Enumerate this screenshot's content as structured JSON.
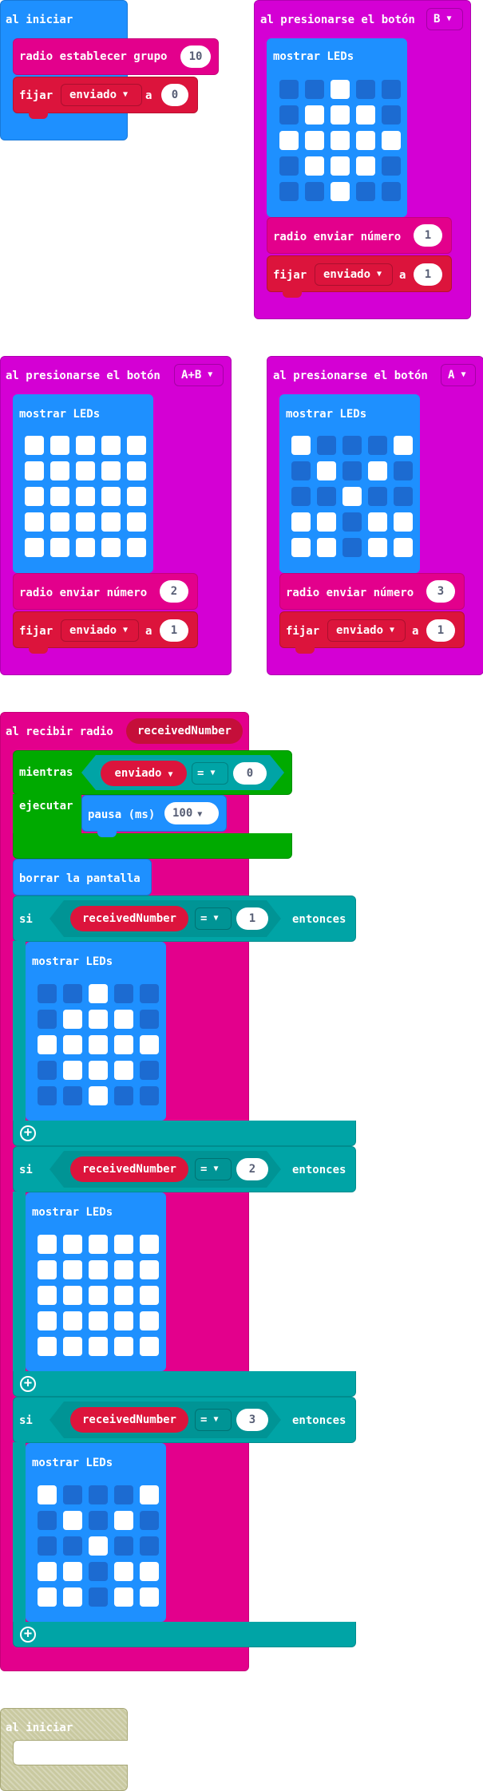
{
  "colors": {
    "basic": "#1e90ff",
    "radio": "#e3008c",
    "input": "#d400d4",
    "variables": "#dc143c",
    "loops": "#00aa00",
    "logic": "#00a4a6",
    "disabled": "#c9c9a0"
  },
  "on_start": {
    "hat_label": "al iniciar",
    "radio_group_label": "radio establecer grupo",
    "radio_group_value": "10",
    "set_label": "fijar",
    "set_variable": "enviado",
    "to_label": "a",
    "set_value": "0"
  },
  "button_b": {
    "hat_label": "al presionarse el botón",
    "button": "B",
    "show_leds_label": "mostrar LEDs",
    "leds": [
      0,
      0,
      1,
      0,
      0,
      0,
      1,
      1,
      1,
      0,
      1,
      1,
      1,
      1,
      1,
      0,
      1,
      1,
      1,
      0,
      0,
      0,
      1,
      0,
      0
    ],
    "send_label": "radio enviar número",
    "send_value": "1",
    "set_label": "fijar",
    "set_variable": "enviado",
    "to_label": "a",
    "set_value": "1"
  },
  "button_ab": {
    "hat_label": "al presionarse el botón",
    "button": "A+B",
    "show_leds_label": "mostrar LEDs",
    "leds": [
      1,
      1,
      1,
      1,
      1,
      1,
      1,
      1,
      1,
      1,
      1,
      1,
      1,
      1,
      1,
      1,
      1,
      1,
      1,
      1,
      1,
      1,
      1,
      1,
      1
    ],
    "send_label": "radio enviar número",
    "send_value": "2",
    "set_label": "fijar",
    "set_variable": "enviado",
    "to_label": "a",
    "set_value": "1"
  },
  "button_a": {
    "hat_label": "al presionarse el botón",
    "button": "A",
    "show_leds_label": "mostrar LEDs",
    "leds": [
      1,
      0,
      0,
      0,
      1,
      0,
      1,
      0,
      1,
      0,
      0,
      0,
      1,
      0,
      0,
      1,
      1,
      0,
      1,
      1,
      1,
      1,
      0,
      1,
      1
    ],
    "send_label": "radio enviar número",
    "send_value": "3",
    "set_label": "fijar",
    "set_variable": "enviado",
    "to_label": "a",
    "set_value": "1"
  },
  "on_received": {
    "hat_label": "al recibir radio",
    "param": "receivedNumber",
    "while_label": "mientras",
    "while_variable": "enviado",
    "while_op": "=",
    "while_value": "0",
    "do_label": "ejecutar",
    "pause_label": "pausa (ms)",
    "pause_value": "100",
    "clear_label": "borrar la pantalla",
    "if_blocks": [
      {
        "if_label": "si",
        "variable": "receivedNumber",
        "op": "=",
        "value": "1",
        "then_label": "entonces",
        "show_leds_label": "mostrar LEDs",
        "leds": [
          0,
          0,
          1,
          0,
          0,
          0,
          1,
          1,
          1,
          0,
          1,
          1,
          1,
          1,
          1,
          0,
          1,
          1,
          1,
          0,
          0,
          0,
          1,
          0,
          0
        ]
      },
      {
        "if_label": "si",
        "variable": "receivedNumber",
        "op": "=",
        "value": "2",
        "then_label": "entonces",
        "show_leds_label": "mostrar LEDs",
        "leds": [
          1,
          1,
          1,
          1,
          1,
          1,
          1,
          1,
          1,
          1,
          1,
          1,
          1,
          1,
          1,
          1,
          1,
          1,
          1,
          1,
          1,
          1,
          1,
          1,
          1
        ]
      },
      {
        "if_label": "si",
        "variable": "receivedNumber",
        "op": "=",
        "value": "3",
        "then_label": "entonces",
        "show_leds_label": "mostrar LEDs",
        "leds": [
          1,
          0,
          0,
          0,
          1,
          0,
          1,
          0,
          1,
          0,
          0,
          0,
          1,
          0,
          0,
          1,
          1,
          0,
          1,
          1,
          1,
          1,
          0,
          1,
          1
        ]
      }
    ]
  },
  "disabled_start": {
    "hat_label": "al iniciar"
  }
}
